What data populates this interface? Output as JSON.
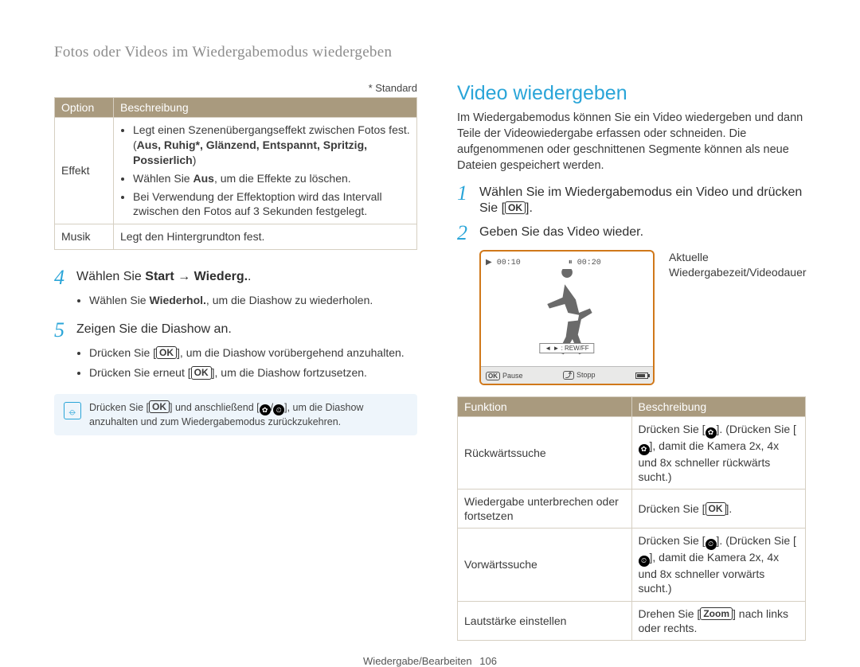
{
  "header": "Fotos oder Videos im Wiedergabemodus wiedergeben",
  "left": {
    "standard_note": "* Standard",
    "opt_head": {
      "c1": "Option",
      "c2": "Beschreibung"
    },
    "rows": {
      "effekt_label": "Effekt",
      "effekt_b1_pre": "Legt einen Szenenübergangseffekt zwischen Fotos fest. (",
      "effekt_b1_bold": "Aus, Ruhig*, Glänzend, Entspannt, Spritzig, Possierlich",
      "effekt_b1_post": ")",
      "effekt_b2_pre": "Wählen Sie ",
      "effekt_b2_bold": "Aus",
      "effekt_b2_post": ", um die Effekte zu löschen.",
      "effekt_b3": "Bei Verwendung der Effektoption wird das Intervall zwischen den Fotos auf 3 Sekunden festgelegt.",
      "musik_label": "Musik",
      "musik_desc": "Legt den Hintergrundton fest."
    },
    "step4": {
      "num": "4",
      "text_pre": "Wählen Sie ",
      "text_bold": "Start → Wiederg.",
      "text_post": ".",
      "sub_pre": "Wählen Sie ",
      "sub_bold": "Wiederhol.",
      "sub_post": ", um die Diashow zu wiederholen."
    },
    "step5": {
      "num": "5",
      "text": "Zeigen Sie die Diashow an.",
      "sub1_pre": "Drücken Sie [",
      "sub1_ok": "OK",
      "sub1_post": "], um die Diashow vorübergehend anzuhalten.",
      "sub2_pre": "Drücken Sie erneut [",
      "sub2_ok": "OK",
      "sub2_post": "], um die Diashow fortzusetzen."
    },
    "note_pre": "Drücken Sie [",
    "note_ok": "OK",
    "note_mid": "] und anschließend [",
    "note_icons_sep": "/",
    "note_post": "], um die Diashow anzuhalten und zum Wiedergabemodus zurückzukehren."
  },
  "right": {
    "title": "Video wiedergeben",
    "intro": "Im Wiedergabemodus können Sie ein Video wiedergeben und dann Teile der Videowiedergabe erfassen oder schneiden. Die aufgenommenen oder geschnittenen Segmente können als neue Dateien gespeichert werden.",
    "step1": {
      "num": "1",
      "text_pre": "Wählen Sie im Wiedergabemodus ein Video und drücken Sie [",
      "ok": "OK",
      "text_post": "]."
    },
    "step2": {
      "num": "2",
      "text": "Geben Sie das Video wieder."
    },
    "lcd": {
      "t1": "00:10",
      "t2": "00:20",
      "rew": "◄ ► : REW/FF",
      "pause_btn": "OK",
      "pause": "Pause",
      "stop_icon": "⤴",
      "stop": "Stopp",
      "caption": "Aktuelle Wiedergabezeit/Videodauer"
    },
    "func_head": {
      "c1": "Funktion",
      "c2": "Beschreibung"
    },
    "func": {
      "r1c1": "Rückwärtssuche",
      "r1c2_pre": "Drücken Sie [",
      "r1c2_mid": "]. (Drücken Sie [",
      "r1c2_post": "], damit die Kamera 2x, 4x und 8x schneller rückwärts sucht.)",
      "r2c1": "Wiedergabe unterbrechen oder fortsetzen",
      "r2c2_pre": "Drücken Sie [",
      "r2c2_ok": "OK",
      "r2c2_post": "].",
      "r3c1": "Vorwärtssuche",
      "r3c2_pre": "Drücken Sie [",
      "r3c2_mid": "]. (Drücken Sie [",
      "r3c2_post": "], damit die Kamera 2x, 4x und 8x schneller vorwärts sucht.)",
      "r4c1": "Lautstärke einstellen",
      "r4c2_pre": "Drehen Sie [",
      "r4c2_bold": "Zoom",
      "r4c2_post": "] nach links oder rechts."
    }
  },
  "footer": {
    "section": "Wiedergabe/Bearbeiten",
    "page": "106"
  }
}
